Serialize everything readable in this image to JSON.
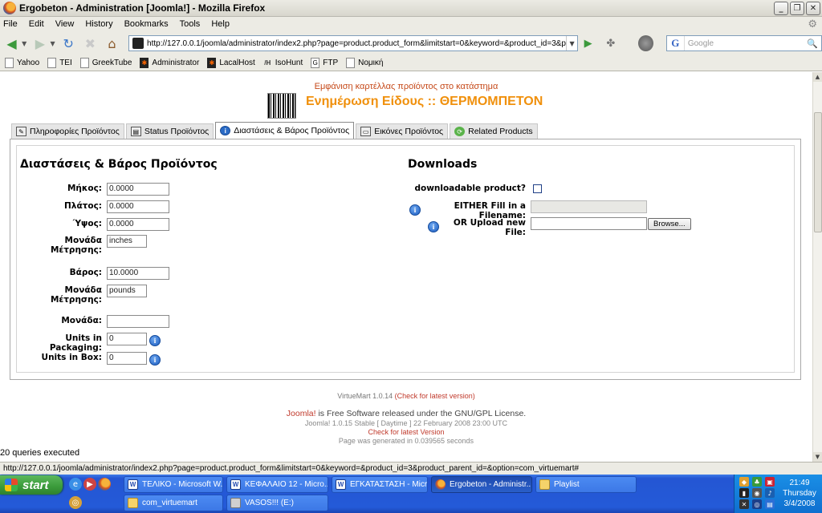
{
  "window": {
    "title": "Ergobeton - Administration [Joomla!] - Mozilla Firefox"
  },
  "menu": [
    "File",
    "Edit",
    "View",
    "History",
    "Bookmarks",
    "Tools",
    "Help"
  ],
  "nav": {
    "url": "http://127.0.0.1/joomla/administrator/index2.php?page=product.product_form&limitstart=0&keyword=&product_id=3&product_parent_",
    "search_placeholder": "Google",
    "search_engine_glyph": "G"
  },
  "bookmarks": [
    "Yahoo",
    "TEI",
    "GreekTube",
    "Administrator",
    "LacalHost",
    "IsoHunt",
    "FTP",
    "Νομική"
  ],
  "page": {
    "subtitle": "Εμφάνιση καρτέλλας προϊόντος στο κατάστημα",
    "title": "Ενημέρωση Είδους :: ΘΕΡΜΟΜΠΕΤΟΝ",
    "tabs": [
      {
        "label": "Πληροφορίες Προϊόντος",
        "active": false
      },
      {
        "label": "Status Προϊόντος",
        "active": false
      },
      {
        "label": "Διαστάσεις & Βάρος Προϊόντος",
        "active": true
      },
      {
        "label": "Εικόνες Προϊόντος",
        "active": false
      },
      {
        "label": "Related Products",
        "active": false
      }
    ],
    "dimensions": {
      "heading": "Διαστάσεις & Βάρος Προϊόντος",
      "length_label": "Μήκος:",
      "length_value": "0.0000",
      "width_label": "Πλάτος:",
      "width_value": "0.0000",
      "height_label": "Ύψος:",
      "height_value": "0.0000",
      "lwh_uom_label": "Μονάδα Μέτρησης:",
      "lwh_uom_value": "inches",
      "weight_label": "Βάρος:",
      "weight_value": "10.0000",
      "weight_uom_label": "Μονάδα Μέτρησης:",
      "weight_uom_value": "pounds",
      "unit_label": "Μονάδα:",
      "unit_value": "",
      "packaging_label": "Units in Packaging:",
      "packaging_value": "0",
      "box_label": "Units in Box:",
      "box_value": "0"
    },
    "downloads": {
      "heading": "Downloads",
      "downloadable_label": "downloadable product?",
      "downloadable_checked": false,
      "filename_label": "EITHER Fill in a Filename:",
      "filename_value": "",
      "upload_label": "OR Upload new File:",
      "browse_label": "Browse..."
    },
    "footer": {
      "vm_version": "VirtueMart 1.0.14",
      "vm_check": "(Check for latest version)",
      "joomla_link": "Joomla!",
      "joomla_text": " is Free Software released under the GNU/GPL License.",
      "joomla_version": "Joomla! 1.0.15 Stable [ Daytime ] 22 February 2008 23:00 UTC",
      "check_latest": "Check for latest Version",
      "generated": "Page was generated in 0.039565 seconds"
    },
    "queries": "20 queries executed"
  },
  "status_url": "http://127.0.0.1/joomla/administrator/index2.php?page=product.product_form&limitstart=0&keyword=&product_id=3&product_parent_id=&option=com_virtuemart#",
  "taskbar": {
    "start_label": "start",
    "buttons_row1": [
      {
        "label": "ΤΕΛΙΚΟ - Microsoft W...",
        "icon": "word",
        "active": false
      },
      {
        "label": "ΚΕΦΑΛΑΙΟ 12 - Micro...",
        "icon": "word",
        "active": false
      },
      {
        "label": "ΕΓΚΑΤΑΣΤΑΣΗ - Micr...",
        "icon": "word",
        "active": false
      },
      {
        "label": "Ergobeton - Administr...",
        "icon": "ff",
        "active": true
      },
      {
        "label": "Playlist",
        "icon": "folder",
        "active": false
      }
    ],
    "buttons_row2": [
      {
        "label": "com_virtuemart",
        "icon": "folder",
        "active": false
      },
      {
        "label": "VASOS!!! (E:)",
        "icon": "drive",
        "active": false
      }
    ],
    "clock": {
      "time": "21:49",
      "day": "Thursday",
      "date": "3/4/2008"
    }
  }
}
